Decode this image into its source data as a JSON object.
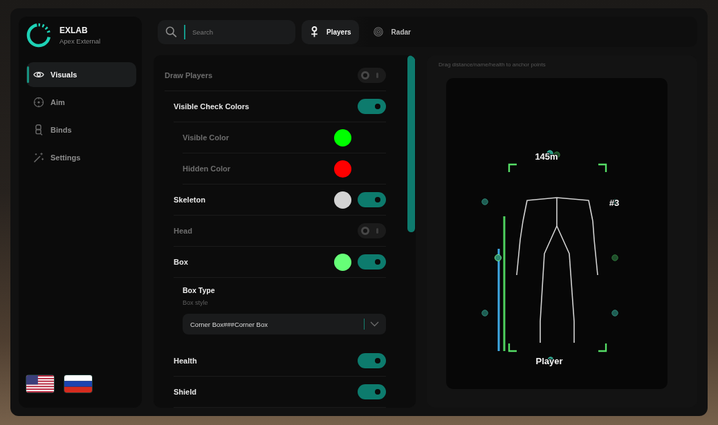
{
  "brand": {
    "title": "EXLAB",
    "subtitle": "Apex External"
  },
  "sidebar": {
    "items": [
      {
        "label": "Visuals",
        "selected": true
      },
      {
        "label": "Aim",
        "selected": false
      },
      {
        "label": "Binds",
        "selected": false
      },
      {
        "label": "Settings",
        "selected": false
      }
    ]
  },
  "search": {
    "placeholder": "Search"
  },
  "tabs": [
    {
      "label": "Players",
      "selected": true
    },
    {
      "label": "Radar",
      "selected": false
    }
  ],
  "settings": [
    {
      "kind": "toggle",
      "label": "Draw Players",
      "on": false,
      "children": [
        {
          "kind": "toggle",
          "label": "Visible Check Colors",
          "on": true,
          "children": [
            {
              "kind": "color",
              "label": "Visible Color",
              "color": "#00ff00"
            },
            {
              "kind": "color",
              "label": "Hidden Color",
              "color": "#ff0000"
            }
          ]
        },
        {
          "kind": "toggle",
          "label": "Skeleton",
          "color": "#d3d3d3",
          "on": true
        },
        {
          "kind": "toggle",
          "label": "Head",
          "on": false
        },
        {
          "kind": "toggle",
          "label": "Box",
          "color": "#66ff77",
          "on": true,
          "children": [
            {
              "kind": "select",
              "label": "Box Type",
              "description": "Box style",
              "value": "Corner Box###Corner Box"
            }
          ]
        },
        {
          "kind": "toggle",
          "label": "Health",
          "on": true
        },
        {
          "kind": "toggle",
          "label": "Shield",
          "on": true
        }
      ]
    }
  ],
  "preview": {
    "hint": "Drag distance/name/health to anchor points",
    "distance": "145m",
    "index": "#3",
    "name": "Player"
  }
}
